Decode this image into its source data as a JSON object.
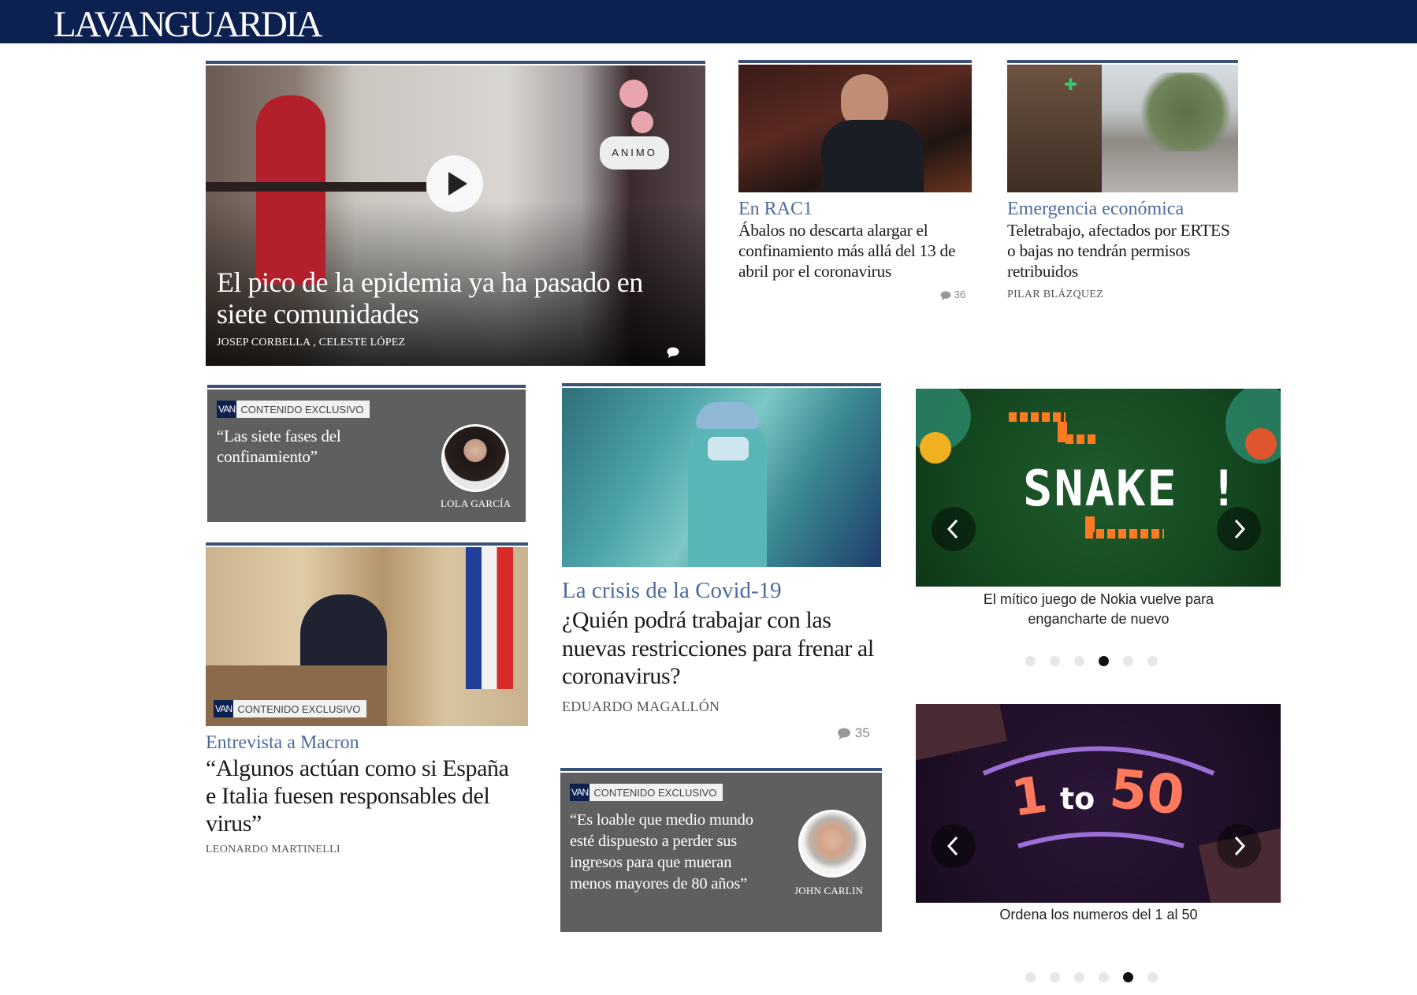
{
  "header": {
    "logo_text": "LAVANGUARDIA",
    "bg_color": "#0d2150"
  },
  "hero": {
    "title": "El pico de la epidemia ya ha pasado en siete comunidades",
    "authors": "JOSEP CORBELLA , CELESTE LÓPEZ",
    "sign_text": "ANIMO",
    "icons": [
      "play-icon",
      "comment-icon"
    ]
  },
  "story_rac1": {
    "kicker": "En RAC1",
    "headline": "Ábalos no descarta alargar el confinamiento más allá del 13 de abril por el coronavirus",
    "comments": "36"
  },
  "story_teletrabajo": {
    "kicker": "Emergencia económica",
    "headline": "Teletrabajo, afectados por ERTES o bajas no tendrán permisos retribuidos",
    "author": "PILAR BLÁZQUEZ"
  },
  "opinion_garcia": {
    "badge_logo": "VAN",
    "badge": "CONTENIDO EXCLUSIVO",
    "quote": "“Las siete fases del confinamiento”",
    "author": "LOLA GARCÍA"
  },
  "story_covid": {
    "kicker": "La crisis de la Covid-19",
    "headline": "¿Quién podrá trabajar con las nuevas restricciones para frenar al coronavirus?",
    "author": "EDUARDO MAGALLÓN",
    "comments": "35"
  },
  "story_macron": {
    "badge_logo": "VAN",
    "badge": "CONTENIDO EXCLUSIVO",
    "kicker": "Entrevista a Macron",
    "headline": "“Algunos actúan como si España e Italia fuesen responsables del virus”",
    "author": "LEONARDO MARTINELLI"
  },
  "opinion_carlin": {
    "badge_logo": "VAN",
    "badge": "CONTENIDO EXCLUSIVO",
    "quote": "“Es loable que medio mundo esté dispuesto a perder sus ingresos para que mueran menos mayores de 80 años”",
    "author": "JOHN CARLIN"
  },
  "game_snake": {
    "title_art": "SNAKE !",
    "caption": "El mítico juego de Nokia vuelve para engancharte de nuevo",
    "dots_total": 6,
    "active_dot": 4
  },
  "game_1to50": {
    "title_art_1": "1",
    "title_art_to": "to",
    "title_art_50": "50",
    "caption": "Ordena los numeros del 1 al 50",
    "dots_total": 6,
    "active_dot": 5
  },
  "colors": {
    "kicker": "#4d6a9c",
    "opinion_bg": "#5f5f5f",
    "card_topline": "#3b5278"
  }
}
